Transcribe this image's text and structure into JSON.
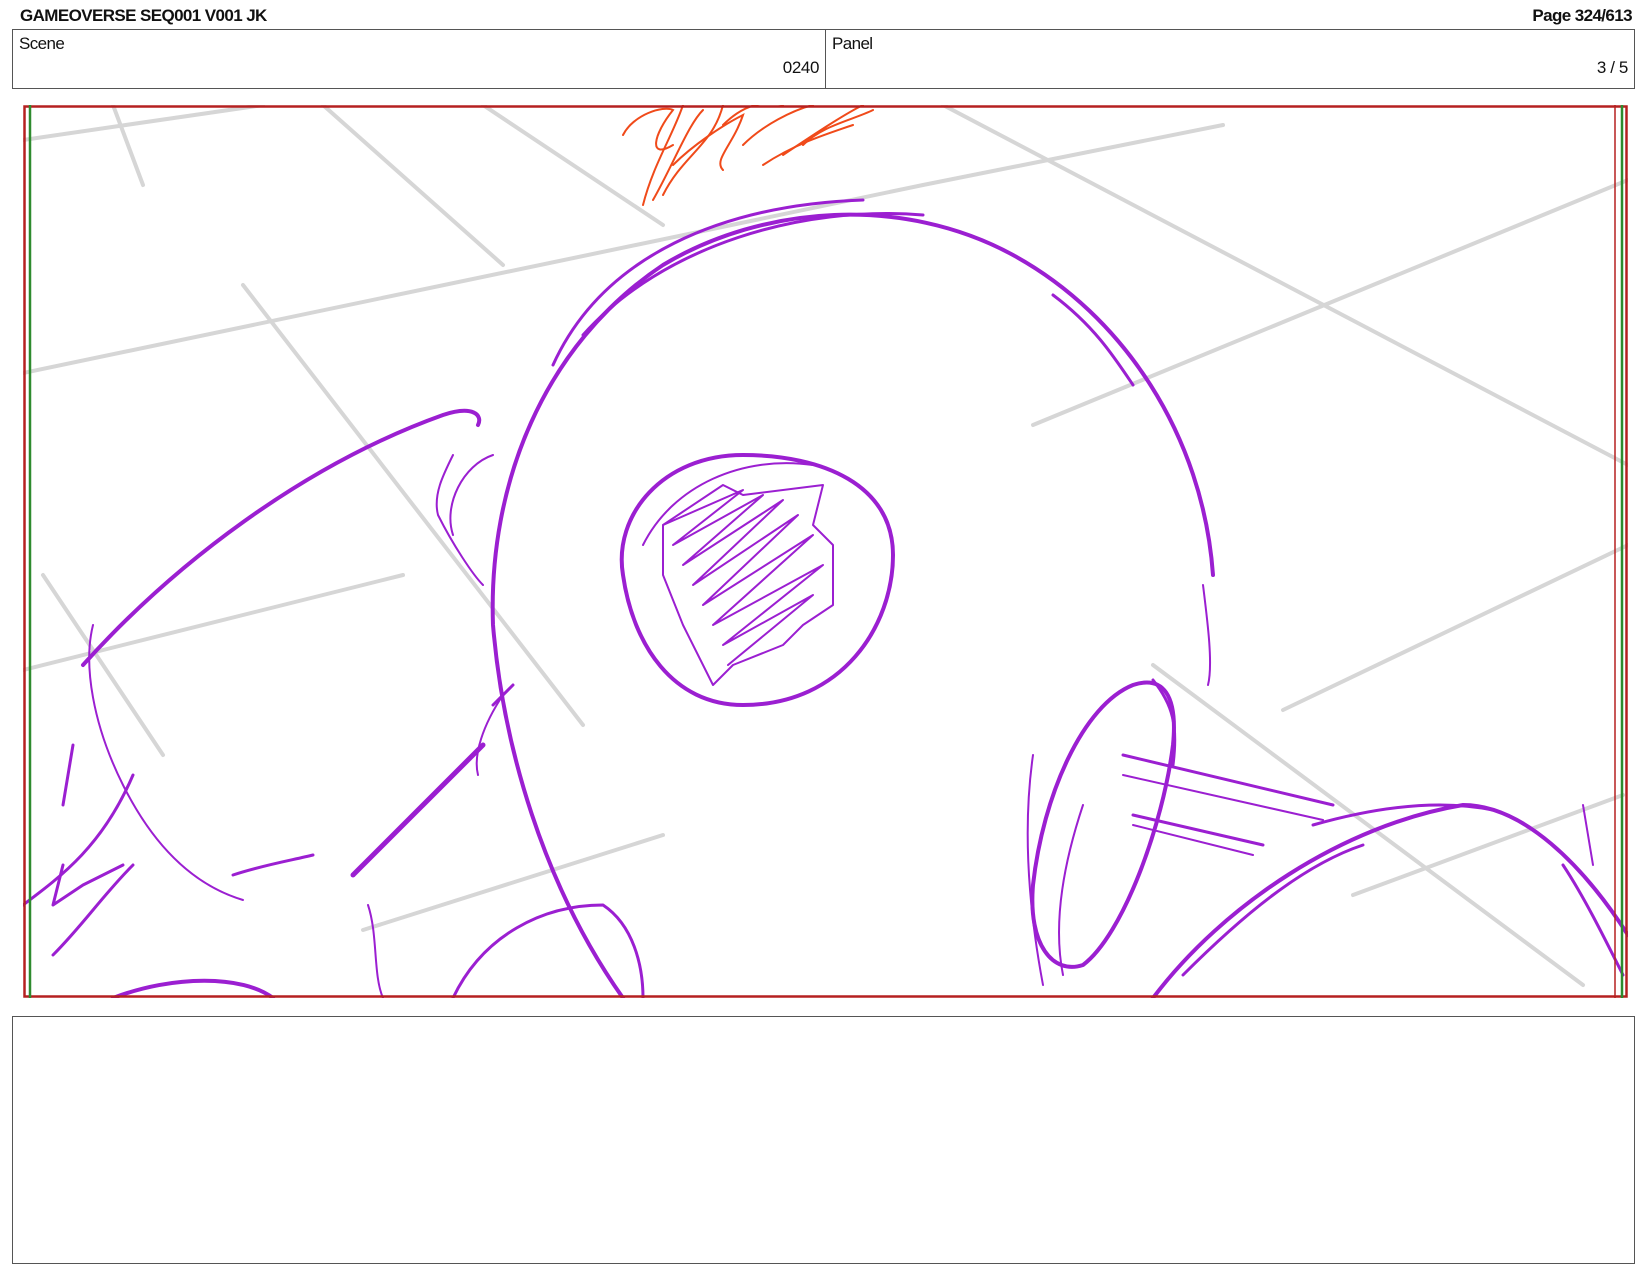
{
  "header": {
    "title": "GAMEOVERSE SEQ001 V001 JK",
    "page": "Page 324/613"
  },
  "scene": {
    "label": "Scene",
    "value": "0240"
  },
  "panel": {
    "label": "Panel",
    "value": "3 / 5"
  },
  "colors": {
    "sketch_purple": "#9b1fd1",
    "sketch_orange": "#f04a1a",
    "grid_gray": "#d6d6d6",
    "frame_red": "#b52020",
    "safe_green": "#2e8b2e"
  },
  "notes": {
    "text": ""
  }
}
